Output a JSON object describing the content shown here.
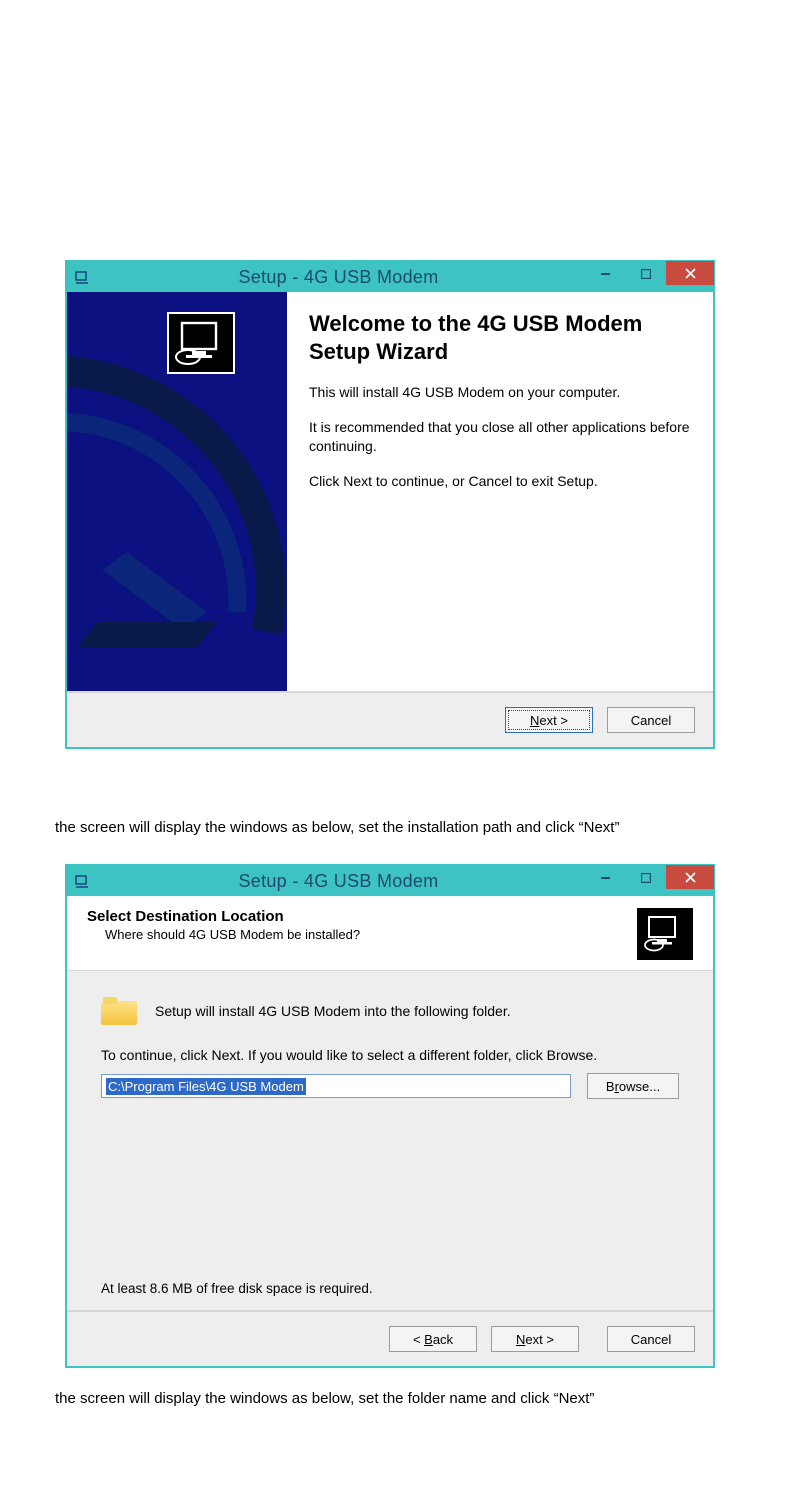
{
  "dialog1": {
    "title": "Setup - 4G USB Modem",
    "heading": "Welcome to the 4G USB Modem Setup Wizard",
    "line1": "This will install 4G USB Modem on your computer.",
    "line2": "It is recommended that you close all other applications before continuing.",
    "line3": "Click Next to continue, or Cancel to exit Setup.",
    "next_label": "Next >",
    "cancel_label": "Cancel"
  },
  "caption1": "the screen will display the windows as below, set the installation path and click “Next”",
  "dialog2": {
    "title": "Setup - 4G USB Modem",
    "header_title": "Select Destination Location",
    "header_sub": "Where should 4G USB Modem be installed?",
    "intro": "Setup will install 4G USB Modem into the following folder.",
    "instruction": "To continue, click Next. If you would like to select a different folder, click Browse.",
    "path_value": "C:\\Program Files\\4G USB Modem",
    "browse_label": "Browse...",
    "disk_req": "At least 8.6 MB of free disk space is required.",
    "back_label": "< Back",
    "next_label": "Next >",
    "cancel_label": "Cancel"
  },
  "caption2": "the screen will display the windows as below, set the folder name and click “Next”"
}
